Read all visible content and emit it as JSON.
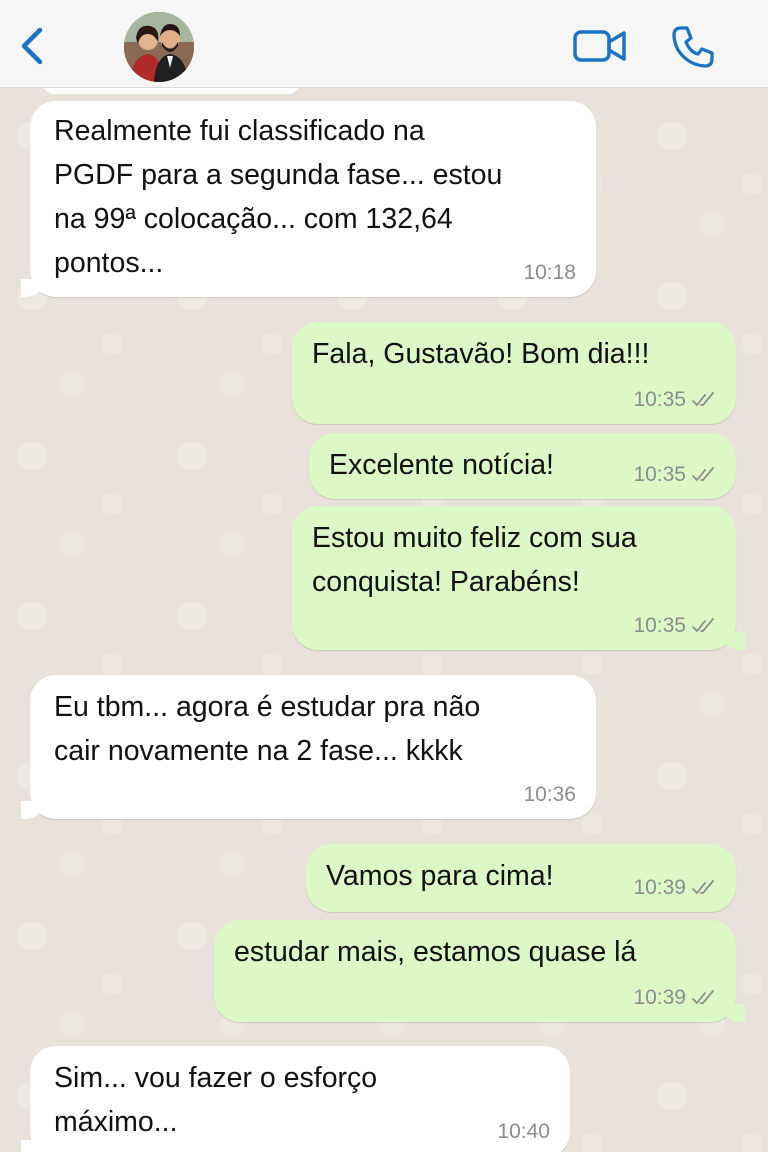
{
  "header": {
    "back_icon": "chevron-left-icon",
    "avatar_icon": "contact-photo-icon",
    "video_icon": "video-camera-icon",
    "phone_icon": "phone-icon",
    "accent_color": "#1a73c4"
  },
  "colors": {
    "incoming_bubble": "#ffffff",
    "outgoing_bubble": "#dcf8c6",
    "chat_background": "#e8e2da",
    "time_text": "#8d8d8d"
  },
  "messages": [
    {
      "direction": "incoming",
      "text": "Realmente fui classificado na\nPGDF para a segunda fase... estou\nna 99ª colocação... com 132,64\npontos...",
      "time": "10:18"
    },
    {
      "direction": "outgoing",
      "text": "Fala, Gustavão! Bom dia!!!",
      "time": "10:35",
      "ticks": "double-check-icon"
    },
    {
      "direction": "outgoing",
      "text": "Excelente notícia!",
      "time": "10:35",
      "ticks": "double-check-icon"
    },
    {
      "direction": "outgoing",
      "text": "Estou muito feliz com sua\nconquista! Parabéns!",
      "time": "10:35",
      "ticks": "double-check-icon"
    },
    {
      "direction": "incoming",
      "text": "Eu tbm... agora é estudar pra não\ncair novamente na 2 fase... kkkk",
      "time": "10:36"
    },
    {
      "direction": "outgoing",
      "text": "Vamos para cima!",
      "time": "10:39",
      "ticks": "double-check-icon"
    },
    {
      "direction": "outgoing",
      "text": "estudar mais, estamos quase lá",
      "time": "10:39",
      "ticks": "double-check-icon"
    },
    {
      "direction": "incoming",
      "text": "Sim... vou fazer o esforço\nmáximo...",
      "time": "10:40"
    }
  ]
}
